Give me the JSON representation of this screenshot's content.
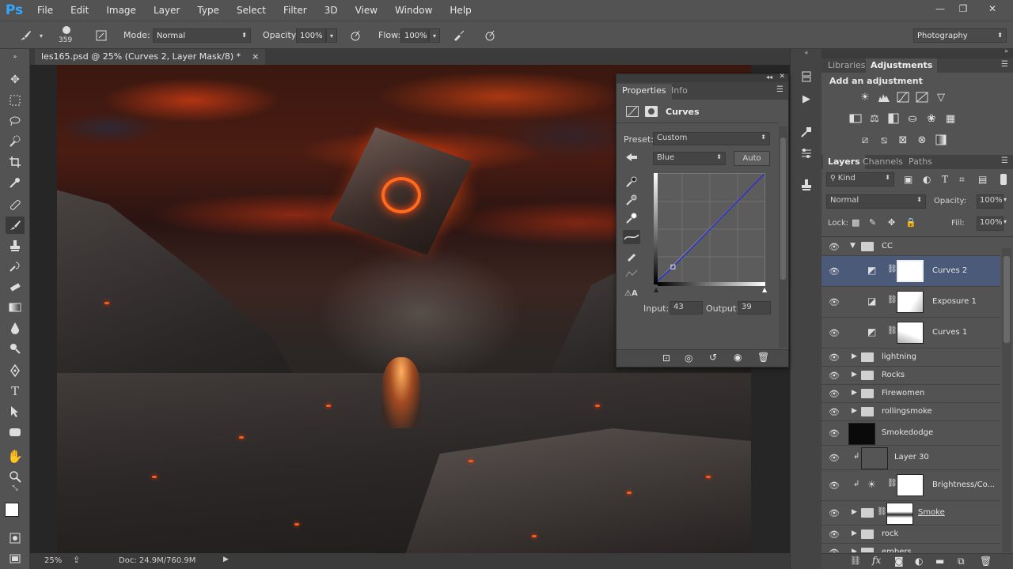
{
  "app": {
    "logo": "Ps"
  },
  "menu": [
    "File",
    "Edit",
    "Image",
    "Layer",
    "Type",
    "Select",
    "Filter",
    "3D",
    "View",
    "Window",
    "Help"
  ],
  "window_controls": {
    "minimize": "—",
    "restore": "❐",
    "close": "✕"
  },
  "options_bar": {
    "brush_size": "359",
    "mode_label": "Mode:",
    "mode_value": "Normal",
    "opacity_label": "Opacity:",
    "opacity_value": "100%",
    "flow_label": "Flow:",
    "flow_value": "100%",
    "workspace": "Photography"
  },
  "document_tab": {
    "title": "les165.psd @ 25% (Curves 2, Layer Mask/8) *",
    "close": "×"
  },
  "status": {
    "zoom": "25%",
    "doc": "Doc: 24.9M/760.9M"
  },
  "properties": {
    "tabs": [
      "Properties",
      "Info"
    ],
    "adjustment_name": "Curves",
    "preset_label": "Preset:",
    "preset_value": "Custom",
    "channel_value": "Blue",
    "auto_label": "Auto",
    "input_label": "Input:",
    "input_value": "43",
    "output_label": "Output:",
    "output_value": "39"
  },
  "adjustments_panel": {
    "tabs": [
      "Libraries",
      "Adjustments"
    ],
    "title": "Add an adjustment"
  },
  "layers_panel": {
    "tabs": [
      "Layers",
      "Channels",
      "Paths"
    ],
    "kind_label": "Kind",
    "blend_mode": "Normal",
    "opacity_label": "Opacity:",
    "opacity_value": "100%",
    "lock_label": "Lock:",
    "fill_label": "Fill:",
    "fill_value": "100%",
    "layers": [
      {
        "name": "CC",
        "type": "group-open"
      },
      {
        "name": "Curves 2",
        "type": "curves",
        "selected": true
      },
      {
        "name": "Exposure 1",
        "type": "exposure"
      },
      {
        "name": "Curves 1",
        "type": "curves"
      },
      {
        "name": "lightning",
        "type": "group"
      },
      {
        "name": "Rocks",
        "type": "group"
      },
      {
        "name": "Firewomen",
        "type": "group"
      },
      {
        "name": "rollingsmoke",
        "type": "group"
      },
      {
        "name": "Smokedodge",
        "type": "pixel"
      },
      {
        "name": "Layer 30",
        "type": "pixel-clipped"
      },
      {
        "name": "Brightness/Co...",
        "type": "brightness"
      },
      {
        "name": "Smoke",
        "type": "group-masked"
      },
      {
        "name": "rock",
        "type": "group"
      },
      {
        "name": "embers",
        "type": "group"
      }
    ]
  },
  "colors": {
    "panel": "#535353",
    "dark": "#3b3b3b",
    "selection": "#4b5a79",
    "curve": "#2b2bd6"
  }
}
